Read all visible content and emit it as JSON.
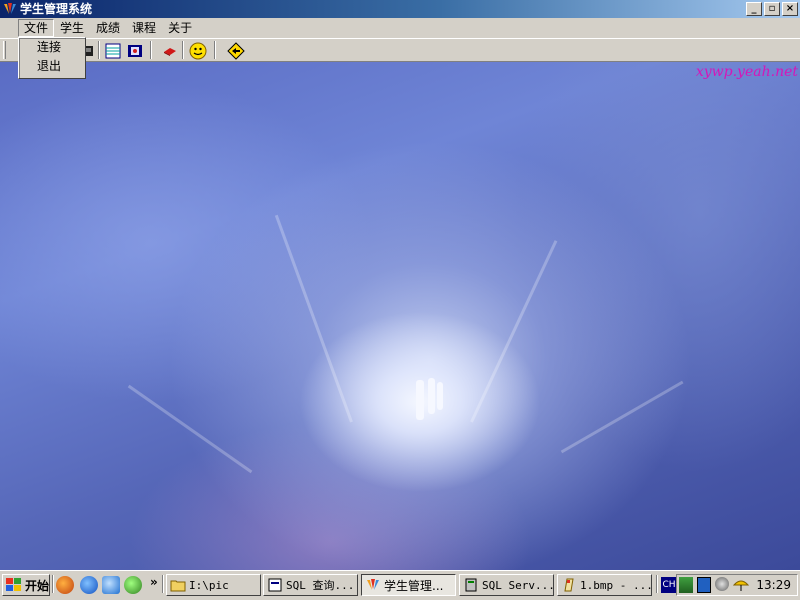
{
  "window": {
    "title": "学生管理系统",
    "buttons": {
      "minimize": "_",
      "restore": "▫",
      "close": "×"
    }
  },
  "menu": {
    "items": [
      "文件",
      "学生",
      "成绩",
      "课程",
      "关于"
    ],
    "active_index": 0,
    "dropdown": [
      "连接",
      "退出"
    ]
  },
  "toolbar": {
    "icons": [
      "connect-icon",
      "table-icon",
      "film-icon",
      "book-icon",
      "smiley-icon",
      "diamond-arrow-icon"
    ]
  },
  "client": {
    "watermark": "xywp.yeah.net"
  },
  "taskbar": {
    "start_label": "开始",
    "overflow": "»",
    "tasks": [
      {
        "label": "I:\\pic",
        "icon": "folder-icon"
      },
      {
        "label": "SQL 查询...",
        "icon": "sql-query-icon"
      },
      {
        "label": "学生管理...",
        "icon": "app-icon"
      },
      {
        "label": "SQL Serv...",
        "icon": "sql-server-icon"
      },
      {
        "label": "1.bmp - ...",
        "icon": "paint-icon"
      }
    ],
    "lang_indicator": "CH",
    "clock": "13:29"
  },
  "colors": {
    "title_start": "#0a246a",
    "title_end": "#a6caf0",
    "face": "#d4d0c8",
    "watermark": "#d616b8"
  }
}
